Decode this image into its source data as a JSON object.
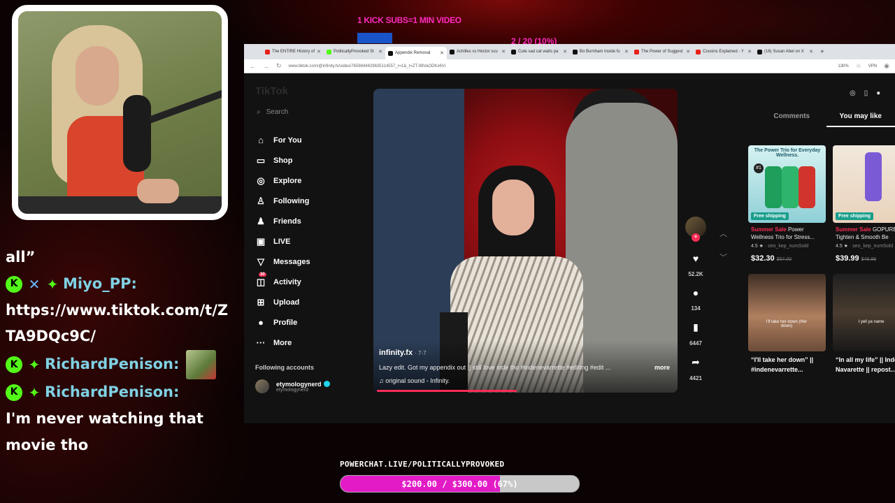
{
  "overlay": {
    "kick_subs": "1 KICK SUBS=1 MIN VIDEO",
    "sub_progress": "2 / 20 (10%)"
  },
  "chat": {
    "prev_fragment": "all”",
    "messages": [
      {
        "user": "Miyo_PP:",
        "text": "https://www.tiktok.com/t/ZTA9DQc9C/"
      },
      {
        "user": "RichardPenison:",
        "text": ""
      },
      {
        "user": "RichardPenison:",
        "text": "I'm never watching that movie tho"
      }
    ]
  },
  "browser": {
    "tabs": [
      {
        "title": "The ENTIRE History of",
        "color": "#e62117"
      },
      {
        "title": "PoliticallyProvoked St",
        "color": "#53fc18"
      },
      {
        "title": "Appendix Removal",
        "color": "#111111",
        "active": true
      },
      {
        "title": "Achilles vs Hector scu",
        "color": "#111111"
      },
      {
        "title": "Cute sad cat waits pa",
        "color": "#111111"
      },
      {
        "title": "Bo Burnham Inside fu",
        "color": "#111111"
      },
      {
        "title": "The Power of Suggest",
        "color": "#e62117"
      },
      {
        "title": "Cousins Explained - Y",
        "color": "#e62117"
      },
      {
        "title": "(16) Susan Abel on X",
        "color": "#111111"
      }
    ],
    "url": "www.tiktok.com/@infinity.fx/video/7659844429635114557_r=1&_t=ZT-98VaODKx6Vi",
    "zoom": "130%",
    "vpn": "VPN"
  },
  "tiktok": {
    "logo": "TikTok",
    "search_placeholder": "Search",
    "nav": [
      {
        "label": "For You",
        "icon": "home-icon"
      },
      {
        "label": "Shop",
        "icon": "shop-icon"
      },
      {
        "label": "Explore",
        "icon": "compass-icon"
      },
      {
        "label": "Following",
        "icon": "following-icon"
      },
      {
        "label": "Friends",
        "icon": "friends-icon"
      },
      {
        "label": "LIVE",
        "icon": "live-icon"
      },
      {
        "label": "Messages",
        "icon": "messages-icon"
      },
      {
        "label": "Activity",
        "icon": "activity-icon",
        "badge": "30"
      },
      {
        "label": "Upload",
        "icon": "upload-icon"
      },
      {
        "label": "Profile",
        "icon": "profile-icon"
      },
      {
        "label": "More",
        "icon": "more-icon"
      }
    ],
    "following_header": "Following accounts",
    "following_account": {
      "name": "etymologynerd",
      "handle": "etymologynerd"
    },
    "video": {
      "username": "infinity.fx",
      "date": "· 7-7",
      "description": "Lazy edit. Got my appendix out || still love inde tho #indenevarrette #editing #edit ...",
      "more": "more",
      "sound": "original sound - Infinity.",
      "progress": 0.47
    },
    "actions": {
      "likes": "52.2K",
      "comments": "134",
      "saves": "6447",
      "shares": "4421"
    },
    "side_tabs": {
      "comments": "Comments",
      "you_may_like": "You may like"
    },
    "cards": [
      {
        "type": "product",
        "thumb_title": "The Power Trio for Everyday Wellness.",
        "rank": "#1",
        "shipping": "Free shipping",
        "sale": "Summer Sale",
        "title": "Power Wellness Trio for Stress...",
        "rating": "4.5 ★",
        "seller": "· seo_kep_numSold",
        "price": "$32.30",
        "old_price": "$57.00"
      },
      {
        "type": "product",
        "thumb_title": "",
        "rank": "",
        "shipping": "Free shipping",
        "sale": "Summer Sale",
        "title": "GOPURE Tighten & Smooth Be",
        "rating": "4.5 ★",
        "seller": "· seo_kep_numSold",
        "price": "$39.99",
        "old_price": "$46.99"
      },
      {
        "type": "video",
        "overlay_text": "I'll take her down (Her down)",
        "title": "“I'll take her down” || #indenevarrette..."
      },
      {
        "type": "video",
        "overlay_text": "I yell ya name",
        "title": "“In all my life” || Inde Navarette || repost..."
      }
    ]
  },
  "powerchat": {
    "label": "POWERCHAT.LIVE/POLITICALLYPROVOKED",
    "amount": "$200.00 / $300.00 (67%)",
    "progress": 0.67
  }
}
